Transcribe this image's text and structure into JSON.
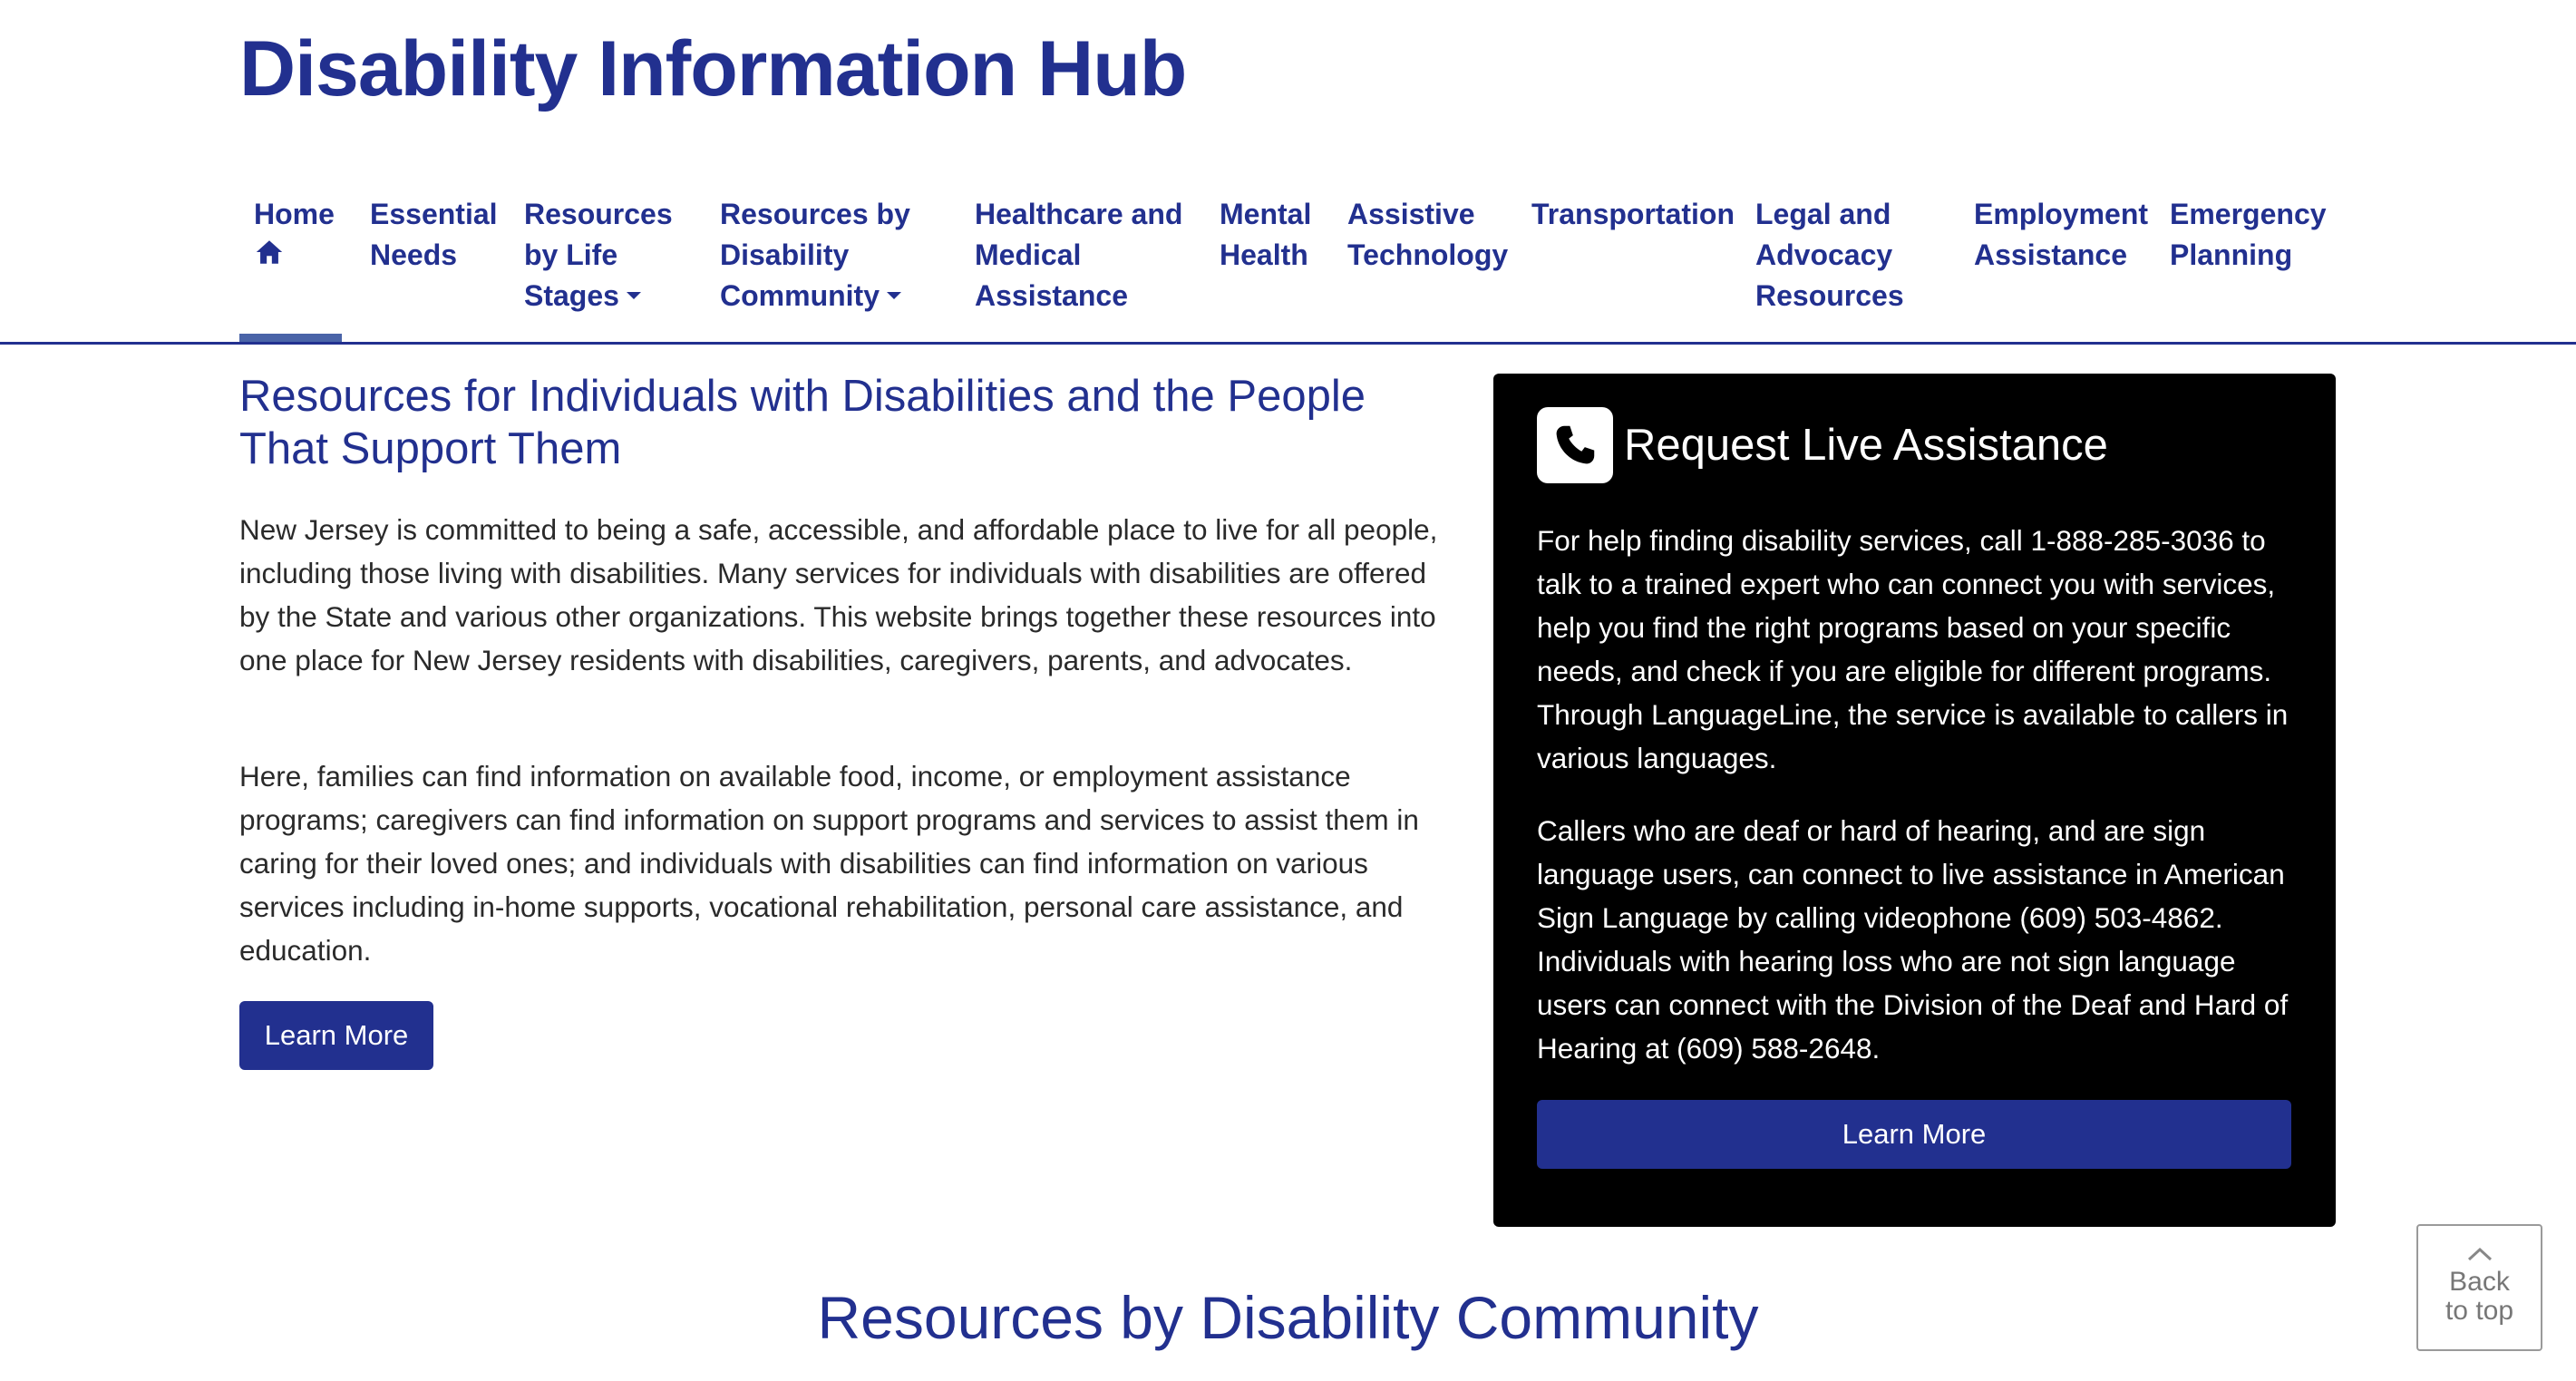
{
  "header": {
    "site_title": "Disability Information Hub"
  },
  "nav": {
    "items": [
      {
        "label": "Home",
        "icon": "home-icon",
        "active": true
      },
      {
        "label": "Essential Needs"
      },
      {
        "label": "Resources by Life Stages",
        "has_dropdown": true
      },
      {
        "label": "Resources by Disability Community",
        "has_dropdown": true
      },
      {
        "label": "Healthcare and Medical Assistance"
      },
      {
        "label": "Mental Health"
      },
      {
        "label": "Assistive Technology"
      },
      {
        "label": "Transportation"
      },
      {
        "label": "Legal and Advocacy Resources"
      },
      {
        "label": "Employment Assistance"
      },
      {
        "label": "Emergency Planning"
      }
    ]
  },
  "main": {
    "heading": "Resources for Individuals with Disabilities and the People That Support Them",
    "paragraph_1": "New Jersey is committed to being a safe, accessible, and affordable place to live for all people, including those living with disabilities. Many services for individuals with disabilities are offered by the State and various other organizations. This website brings together these resources into one place for New Jersey residents with disabilities, caregivers, parents, and advocates.",
    "paragraph_2": "Here, families can find information on available food, income, or employment assistance programs; caregivers can find information on support programs and services to assist them in caring for their loved ones; and individuals with disabilities can find information on various services including in-home supports, vocational rehabilitation, personal care assistance, and education.",
    "learn_more_label": "Learn More"
  },
  "assistance": {
    "icon": "phone-icon",
    "title": "Request Live Assistance",
    "paragraph_1": "For help finding disability services, call 1-888-285-3036 to talk to a trained expert who can connect you with services, help you find the right programs based on your specific needs, and check if you are eligible for different programs. Through LanguageLine, the service is available to callers in various languages.",
    "paragraph_2": "Callers who are deaf or hard of hearing, and are sign language users, can connect to live assistance in American Sign Language by calling videophone (609) 503-4862. Individuals with hearing loss who are not sign language users can connect with the Division of the Deaf and Hard of Hearing at (609) 588-2648.",
    "learn_more_label": "Learn More"
  },
  "section": {
    "heading": "Resources by Disability Community"
  },
  "back_to_top": {
    "icon": "chevron-up-icon",
    "label": "Back to top"
  },
  "colors": {
    "brand_blue": "#22308f",
    "active_tab_bar": "#4a64a8",
    "card_background": "#000000"
  }
}
